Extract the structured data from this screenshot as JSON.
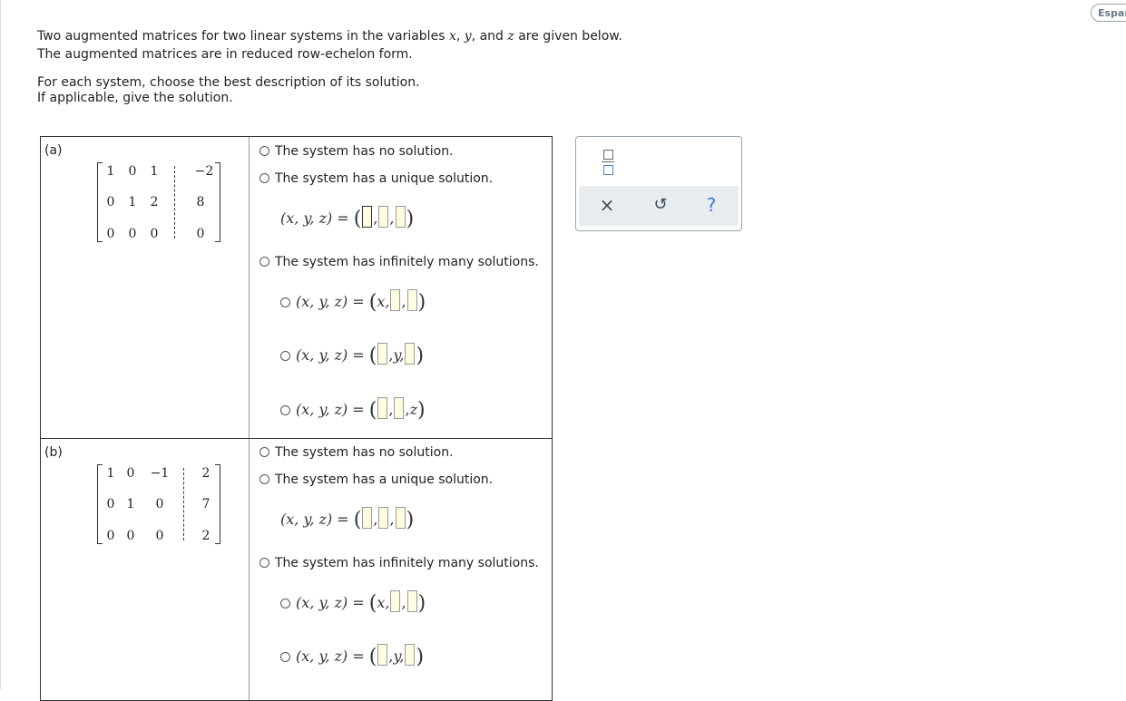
{
  "language_button": "Españ",
  "intro": {
    "line1_pre": "Two augmented matrices for two linear systems in the variables ",
    "var_x": "x",
    "comma1": ", ",
    "var_y": "y",
    "comma2": ", and ",
    "var_z": "z",
    "line1_post": " are given below.",
    "line2": "The augmented matrices are in reduced row-echelon form.",
    "line3": "For each system, choose the best description of its solution.",
    "line4": "If applicable, give the solution."
  },
  "lhs": "(x, y, z) =",
  "problems": [
    {
      "label": "(a)",
      "matrix": [
        [
          "1",
          "0",
          "1",
          "−2"
        ],
        [
          "0",
          "1",
          "2",
          "8"
        ],
        [
          "0",
          "0",
          "0",
          "0"
        ]
      ],
      "options": {
        "no_solution": "The system has no solution.",
        "unique": "The system has a unique solution.",
        "infinite": "The system has infinitely many solutions."
      },
      "param_vars": {
        "x": "x,",
        "y": "y,",
        "z": "z"
      }
    },
    {
      "label": "(b)",
      "matrix": [
        [
          "1",
          "0",
          "−1",
          "2"
        ],
        [
          "0",
          "1",
          "0",
          "7"
        ],
        [
          "0",
          "0",
          "0",
          "2"
        ]
      ],
      "options": {
        "no_solution": "The system has no solution.",
        "unique": "The system has a unique solution.",
        "infinite": "The system has infinitely many solutions."
      },
      "param_vars": {
        "x": "x,",
        "y": "y,"
      }
    }
  ],
  "toolbar": {
    "fraction_icon": "fraction-icon",
    "clear_icon": "×",
    "undo_icon": "↺",
    "help_icon": "?"
  }
}
